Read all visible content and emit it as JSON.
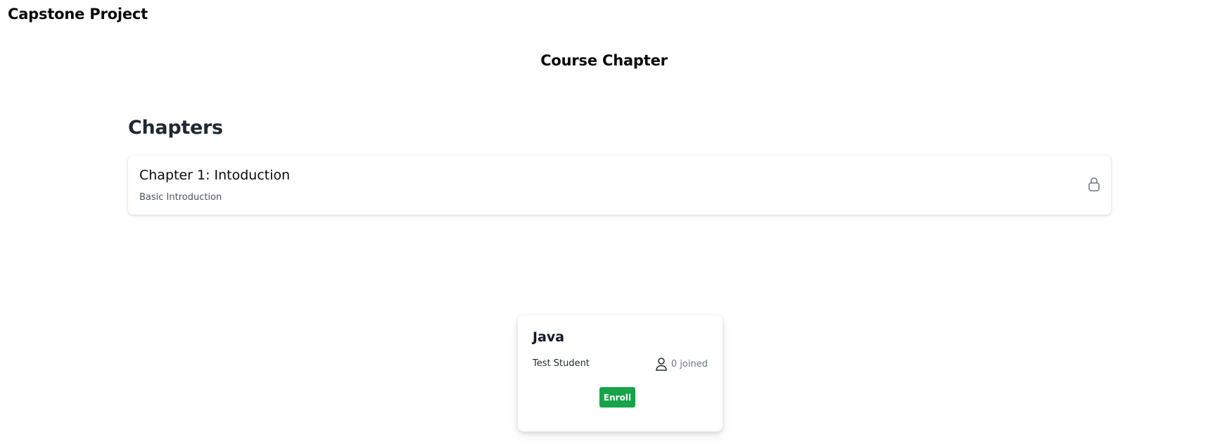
{
  "app": {
    "title": "Capstone Project"
  },
  "page": {
    "heading": "Course Chapter"
  },
  "chapters_section": {
    "title": "Chapters",
    "items": [
      {
        "title": "Chapter 1: Intoduction",
        "description": "Basic Introduction",
        "icon": "lock-icon"
      }
    ]
  },
  "course_card": {
    "title": "Java",
    "author": "Test Student",
    "joined_text": "0 joined",
    "user_icon": "user-icon",
    "enroll_label": "Enroll",
    "enroll_color": "#16a34a"
  }
}
